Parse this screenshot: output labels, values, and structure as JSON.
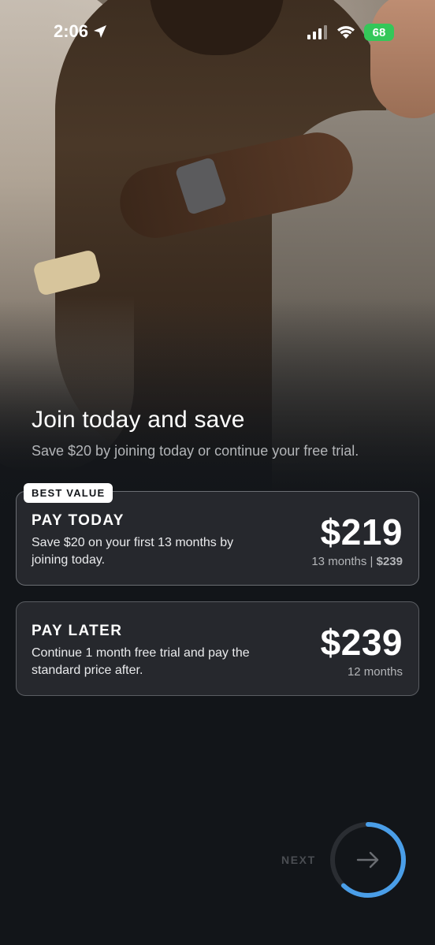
{
  "status_bar": {
    "time": "2:06",
    "battery": "68",
    "icons": [
      "location-arrow-icon",
      "signal-bars-icon",
      "wifi-icon",
      "battery-charging-icon"
    ]
  },
  "hero": {
    "image": "three people wearing wrist bands"
  },
  "header": {
    "title": "Join today and save",
    "subtitle": "Save $20 by joining today or continue your free trial."
  },
  "plans": [
    {
      "badge": "BEST VALUE",
      "title": "PAY TODAY",
      "description": "Save $20 on your first 13 months by joining today.",
      "price": "$219",
      "note": "13 months | ",
      "note_strike": "$239",
      "selected": true
    },
    {
      "title": "PAY LATER",
      "description": "Continue 1 month free trial and pay the standard price after.",
      "price": "$239",
      "note": "12 months",
      "selected": false
    }
  ],
  "next": {
    "label": "NEXT",
    "progress": 0.62,
    "icon": "arrow-right-icon",
    "ring_color": "#4a9ee8",
    "track_color": "#2a2d32"
  }
}
